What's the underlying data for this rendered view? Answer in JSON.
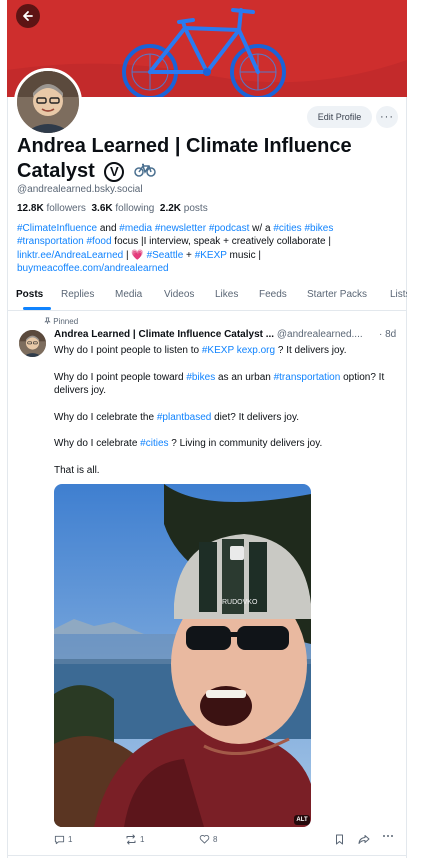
{
  "profile": {
    "name": "Andrea Learned | Climate Influence Catalyst",
    "badge": "V",
    "handle": "@andrealearned.bsky.social",
    "followers": "12.8K",
    "followers_label": "followers",
    "following": "3.6K",
    "following_label": "following",
    "posts": "2.2K",
    "posts_label": "posts",
    "edit_label": "Edit Profile",
    "more_label": "···",
    "bio": {
      "h_climate": "#ClimateInfluence",
      "and": " and ",
      "h_media": "#media",
      "h_newsletter": "#newsletter",
      "h_podcast": "#podcast",
      "wa": " w/ a ",
      "h_cities": "#cities",
      "h_bikes": "#bikes",
      "h_transportation": "#transportation",
      "h_food": "#food",
      "line2_tail": " focus |I interview, speak + creatively collaborate |",
      "link_linktree": "linktr.ee/AndreaLearned",
      "pipe": " | ",
      "heart": "💗",
      "h_seattle": "#Seattle",
      "plus": " + ",
      "h_kexp": "#KEXP",
      "music": " music |",
      "link_coffee": "buymeacoffee.com/andrealearned"
    }
  },
  "tabs": [
    "Posts",
    "Replies",
    "Media",
    "Videos",
    "Likes",
    "Feeds",
    "Starter Packs",
    "Lists"
  ],
  "post": {
    "pinned_label": "Pinned",
    "author": "Andrea Learned | Climate Influence Catalyst ...",
    "handle": "@andrealearned....",
    "time": "· 8d",
    "p1_a": "Why do I point people to listen to ",
    "p1_tag": "#KEXP",
    "p1_link": "kexp.org",
    "p1_b": " ? It delivers joy.",
    "p2_a": "Why do I point people toward ",
    "p2_tag1": "#bikes",
    "p2_b": " as an urban ",
    "p2_tag2": "#transportation",
    "p2_c": " option? It delivers joy.",
    "p3_a": "Why do I celebrate the ",
    "p3_tag": "#plantbased",
    "p3_b": " diet? It delivers joy.",
    "p4_a": "Why do I celebrate ",
    "p4_tag": "#cities",
    "p4_b": " ? Living in community delivers joy.",
    "p5": "That is all.",
    "alt_label": "ALT",
    "helmet_text": "RUDOVKO",
    "reply_count": "1",
    "repost_count": "1",
    "like_count": "8"
  },
  "colors": {
    "accent": "#1083fe",
    "banner": "#cc2c2c",
    "text": "#0b0f14",
    "muted": "#5a6675"
  },
  "icons": [
    "back-arrow-icon",
    "bicycle-icon",
    "pin-icon",
    "reply-icon",
    "repost-icon",
    "like-icon",
    "bookmark-icon",
    "share-icon",
    "more-icon"
  ]
}
